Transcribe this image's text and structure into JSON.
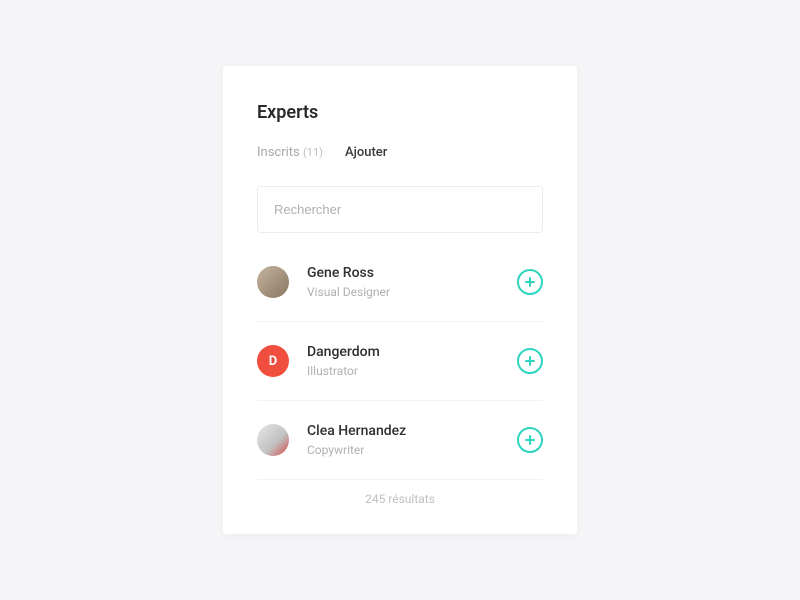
{
  "title": "Experts",
  "tabs": {
    "inscrits_label": "Inscrits",
    "inscrits_count": "(11)",
    "ajouter_label": "Ajouter"
  },
  "search": {
    "placeholder": "Rechercher"
  },
  "people": [
    {
      "name": "Gene Ross",
      "role": "Visual Designer",
      "avatar_letter": ""
    },
    {
      "name": "Dangerdom",
      "role": "Illustrator",
      "avatar_letter": "D"
    },
    {
      "name": "Clea Hernandez",
      "role": "Copywriter",
      "avatar_letter": ""
    }
  ],
  "footer": {
    "results_text": "245 résultats"
  }
}
